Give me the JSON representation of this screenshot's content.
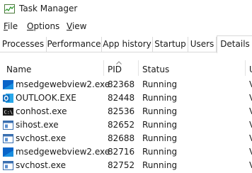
{
  "window": {
    "title": "Task Manager"
  },
  "menu": {
    "file": "File",
    "options": "Options",
    "view": "View"
  },
  "tabs": [
    "Processes",
    "Performance",
    "App history",
    "Startup",
    "Users",
    "Details"
  ],
  "active_tab": "Details",
  "columns": {
    "name": "Name",
    "pid": "PID",
    "status": "Status",
    "user": "U"
  },
  "rows": [
    {
      "name": "msedgewebview2.exe",
      "pid": "82368",
      "status": "Running",
      "user": "V",
      "icon": "edge-webview-icon"
    },
    {
      "name": "OUTLOOK.EXE",
      "pid": "82448",
      "status": "Running",
      "user": "V",
      "icon": "outlook-icon"
    },
    {
      "name": "conhost.exe",
      "pid": "82536",
      "status": "Running",
      "user": "V",
      "icon": "console-icon"
    },
    {
      "name": "sihost.exe",
      "pid": "82652",
      "status": "Running",
      "user": "V",
      "icon": "system-process-icon"
    },
    {
      "name": "svchost.exe",
      "pid": "82688",
      "status": "Running",
      "user": "V",
      "icon": "system-process-icon"
    },
    {
      "name": "msedgewebview2.exe",
      "pid": "82716",
      "status": "Running",
      "user": "V",
      "icon": "edge-webview-icon"
    },
    {
      "name": "svchost.exe",
      "pid": "82752",
      "status": "Running",
      "user": "V",
      "icon": "system-process-icon"
    }
  ],
  "colors": {
    "accent": "#0a64c8",
    "outlook": "#0f6cbd",
    "separator": "#d9d9d9"
  }
}
